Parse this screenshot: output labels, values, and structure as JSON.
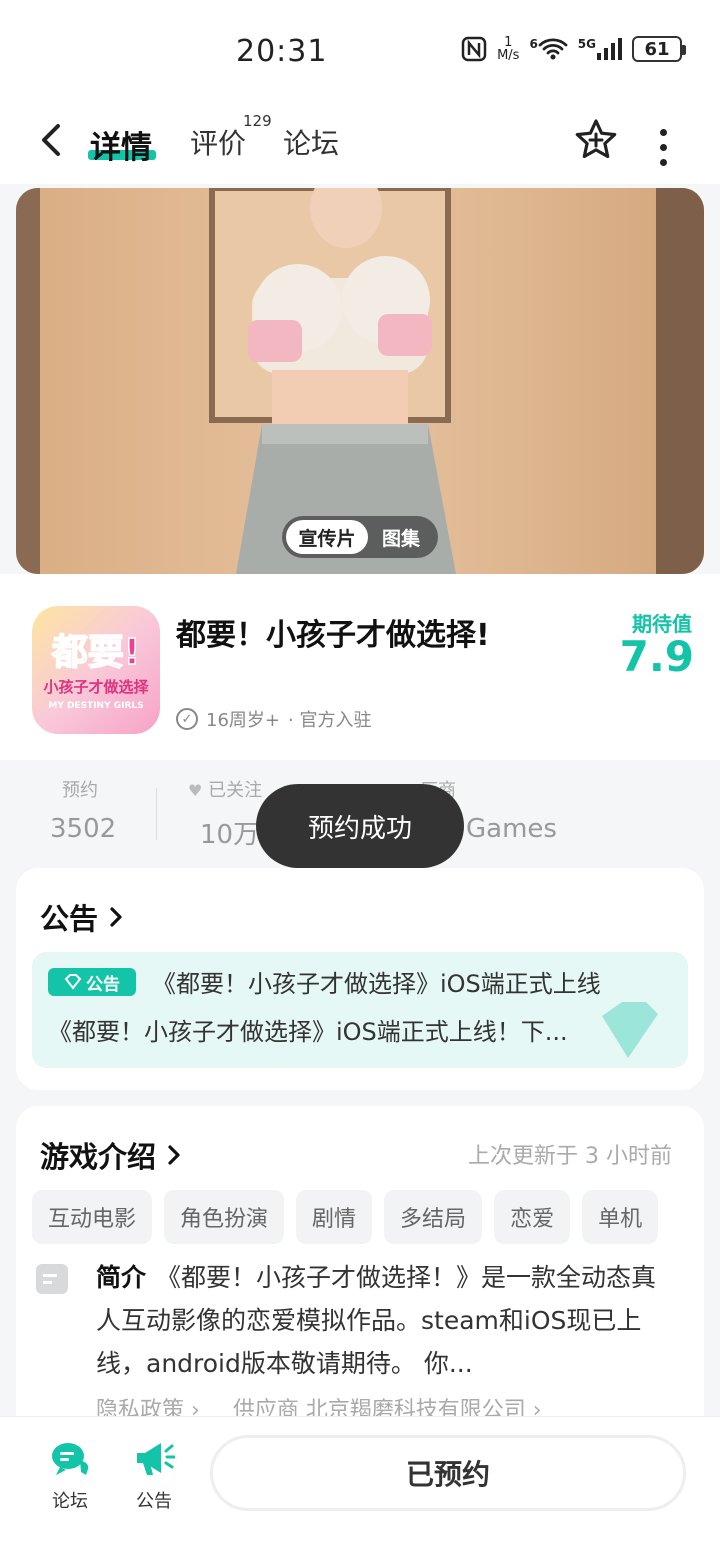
{
  "status_bar": {
    "time": "20:31",
    "net_speed_top": "1",
    "net_speed_bottom": "M/s",
    "wifi_label": "6",
    "cell_label": "5G",
    "battery": "61"
  },
  "nav": {
    "tabs": [
      {
        "label": "详情",
        "active": true
      },
      {
        "label": "评价",
        "count": "129"
      },
      {
        "label": "论坛"
      }
    ]
  },
  "media": {
    "switch": [
      {
        "label": "宣传片",
        "active": true
      },
      {
        "label": "图集"
      }
    ]
  },
  "app": {
    "icon_text_main": "都要!",
    "icon_text_sub": "小孩子才做选择",
    "icon_text_en": "MY DESTINY GIRLS",
    "title": "都要！小孩子才做选择!",
    "rating_label": "16周岁+",
    "meta_suffix": "· 官方入驻",
    "expect_label": "期待值",
    "expect_value": "7.9"
  },
  "stats": [
    {
      "label": "预约",
      "value": "3502"
    },
    {
      "label": "已关注",
      "value": "10万"
    },
    {
      "label": "厂商",
      "value": "Games"
    }
  ],
  "toast": "预约成功",
  "notice": {
    "title": "公告",
    "badge": "公告",
    "line1": "《都要！小孩子才做选择》iOS端正式上线",
    "line2": "《都要！小孩子才做选择》iOS端正式上线！下..."
  },
  "intro": {
    "title": "游戏介绍",
    "updated": "上次更新于 3 小时前",
    "tags": [
      "互动电影",
      "角色扮演",
      "剧情",
      "多结局",
      "恋爱",
      "单机"
    ],
    "label": "简介",
    "text": "《都要！小孩子才做选择！》是一款全动态真人互动影像的恋爱模拟作品。steam和iOS现已上线，android版本敬请期待。 你...",
    "privacy": "隐私政策",
    "supplier": "供应商 北京羯磨科技有限公司"
  },
  "bottom_bar": {
    "forum": "论坛",
    "notice": "公告",
    "reserve": "已预约"
  },
  "colors": {
    "accent": "#14c4a8",
    "toast": "#333333"
  }
}
